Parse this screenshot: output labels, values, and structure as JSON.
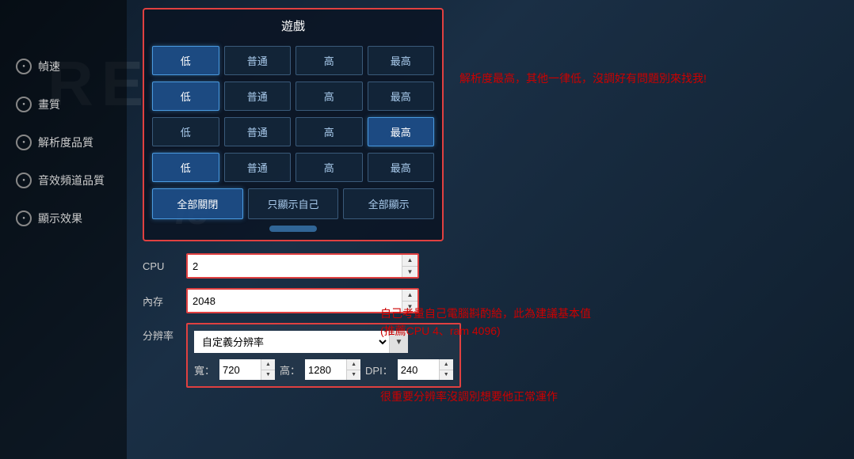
{
  "background": {
    "bg_text": "RE"
  },
  "sidebar": {
    "items": [
      {
        "label": "幀速",
        "id": "framerate"
      },
      {
        "label": "畫質",
        "id": "quality"
      },
      {
        "label": "解析度品質",
        "id": "resolution-quality"
      },
      {
        "label": "音效頻道品質",
        "id": "audio-quality"
      },
      {
        "label": "顯示效果",
        "id": "display-effects"
      }
    ]
  },
  "game_panel": {
    "title": "遊戲",
    "rows": [
      {
        "id": "framerate-row",
        "buttons": [
          {
            "label": "低",
            "active": true
          },
          {
            "label": "普通",
            "active": false
          },
          {
            "label": "高",
            "active": false
          },
          {
            "label": "最高",
            "active": false
          }
        ]
      },
      {
        "id": "quality-row",
        "buttons": [
          {
            "label": "低",
            "active": true
          },
          {
            "label": "普通",
            "active": false
          },
          {
            "label": "高",
            "active": false
          },
          {
            "label": "最高",
            "active": false
          }
        ]
      },
      {
        "id": "res-quality-row",
        "buttons": [
          {
            "label": "低",
            "active": false
          },
          {
            "label": "普通",
            "active": false
          },
          {
            "label": "高",
            "active": false
          },
          {
            "label": "最高",
            "active": true
          }
        ]
      },
      {
        "id": "audio-row",
        "buttons": [
          {
            "label": "低",
            "active": true
          },
          {
            "label": "普通",
            "active": false
          },
          {
            "label": "高",
            "active": false
          },
          {
            "label": "最高",
            "active": false
          }
        ]
      }
    ],
    "display_row": [
      {
        "label": "全部關閉",
        "active": true
      },
      {
        "label": "只顯示自己",
        "active": false
      },
      {
        "label": "全部顯示",
        "active": false
      }
    ]
  },
  "cpu_section": {
    "cpu_label": "CPU",
    "cpu_value": "2",
    "memory_label": "內存",
    "memory_value": "2048",
    "resolution_label": "分辨率",
    "resolution_dropdown_value": "自定義分辨率",
    "width_label": "寬：",
    "width_value": "720",
    "height_label": "高：",
    "height_value": "1280",
    "dpi_label": "DPI：",
    "dpi_value": "240"
  },
  "annotations": {
    "annotation1": "解析度最高，其他一律低，沒調好有問題別來找我!",
    "annotation2_line1": "自己考量自己電腦斟酌給，此為建議基本值",
    "annotation2_line2": "(推薦CPU 4、ram 4096)",
    "annotation3": "很重要分辨率沒調別想要他正常運作"
  },
  "ie_text": "Ie"
}
